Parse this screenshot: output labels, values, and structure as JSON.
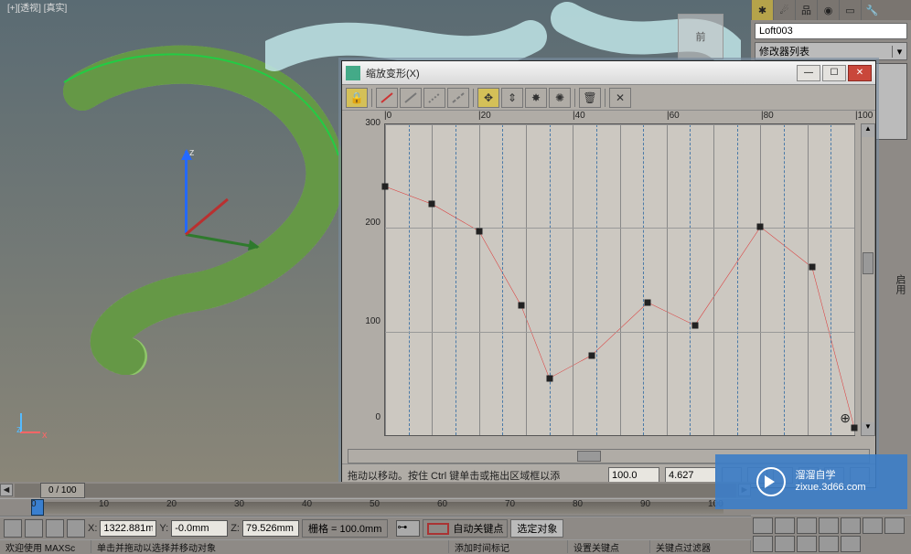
{
  "viewport": {
    "label": "[+][透视] [真实]"
  },
  "right_panel": {
    "object_name": "Loft003",
    "modifier_list": "修改器列表",
    "side_label": "启用"
  },
  "deform_window": {
    "title": "缩放变形(X)",
    "x_ticks": [
      {
        "v": "|0",
        "p": 0
      },
      {
        "v": "|20",
        "p": 20
      },
      {
        "v": "|40",
        "p": 40
      },
      {
        "v": "|60",
        "p": 60
      },
      {
        "v": "|80",
        "p": 80
      },
      {
        "v": "|100",
        "p": 100
      }
    ],
    "y_ticks": [
      {
        "v": "300",
        "p": 0
      },
      {
        "v": "200",
        "p": 33.7
      },
      {
        "v": "100",
        "p": 67.4
      },
      {
        "v": "0",
        "p": 100
      }
    ],
    "hint": "拖动以移动。按住 Ctrl 键单击或拖出区域框以添",
    "val1": "100.0",
    "val2": "4.627"
  },
  "chart_data": {
    "type": "line",
    "title": "缩放变形(X)",
    "xlabel": "",
    "ylabel": "",
    "xlim": [
      0,
      100
    ],
    "ylim": [
      0,
      300
    ],
    "x": [
      0,
      10,
      20,
      29,
      35,
      44,
      56,
      66,
      80,
      91,
      100
    ],
    "values": [
      240,
      223,
      197,
      125,
      55,
      77,
      128,
      106,
      201,
      162,
      7
    ]
  },
  "timeline": {
    "head": "0 / 100"
  },
  "time_ruler": {
    "ticks": [
      {
        "v": "0",
        "p": 34
      },
      {
        "v": "10",
        "p": 108
      },
      {
        "v": "20",
        "p": 182
      },
      {
        "v": "30",
        "p": 256
      },
      {
        "v": "40",
        "p": 330
      },
      {
        "v": "50",
        "p": 404
      },
      {
        "v": "60",
        "p": 478
      },
      {
        "v": "70",
        "p": 552
      },
      {
        "v": "80",
        "p": 626
      },
      {
        "v": "90",
        "p": 700
      },
      {
        "v": "100",
        "p": 774
      }
    ]
  },
  "coord_bar": {
    "x_label": "X:",
    "x": "1322.881m",
    "y_label": "Y:",
    "y": "-0.0mm",
    "z_label": "Z:",
    "z": "79.526mm",
    "grid": "栅格 = 100.0mm",
    "auto_key": "自动关键点",
    "sel_obj": "选定对象"
  },
  "status_bar": {
    "welcome": "欢迎使用  MAXSc",
    "hint2": "单击并拖动以选择并移动对象",
    "hint3": "添加时间标记",
    "hint4": "设置关键点",
    "hint5": "关键点过滤器"
  },
  "watermark": {
    "brand": "溜溜自学",
    "url": "zixue.3d66.com"
  }
}
